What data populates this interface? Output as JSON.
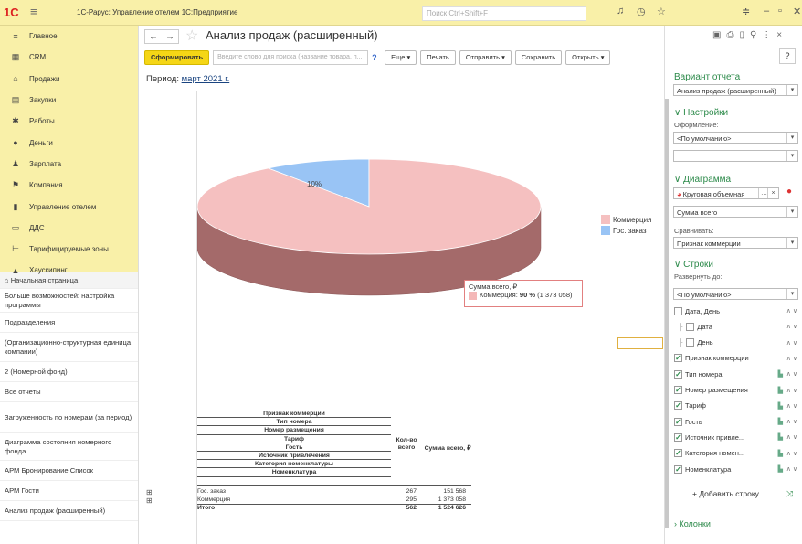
{
  "app": {
    "logo": "1С",
    "title": "1С-Рарус: Управление отелем 1С:Предприятие",
    "search_placeholder": "Поиск Ctrl+Shift+F"
  },
  "sections": [
    {
      "icon": "≡",
      "label": "Главное"
    },
    {
      "icon": "▦",
      "label": "CRM"
    },
    {
      "icon": "⌂",
      "label": "Продажи"
    },
    {
      "icon": "▤",
      "label": "Закупки"
    },
    {
      "icon": "✱",
      "label": "Работы"
    },
    {
      "icon": "●",
      "label": "Деньги"
    },
    {
      "icon": "♟",
      "label": "Зарплата"
    },
    {
      "icon": "⚑",
      "label": "Компания"
    },
    {
      "icon": "▮",
      "label": "Управление отелем"
    },
    {
      "icon": "▭",
      "label": "ДДС"
    },
    {
      "icon": "⊢",
      "label": "Тарифицируемые зоны"
    },
    {
      "icon": "▲",
      "label": "Хаускипинг"
    }
  ],
  "nav": [
    {
      "label": "⌂  Начальная страница",
      "h": 18
    },
    {
      "label": "Больше возможностей: настройка программы",
      "h": 26
    },
    {
      "label": "Подразделения",
      "h": 22
    },
    {
      "label": "(Организационно-структурная единица компании)",
      "h": 32
    },
    {
      "label": "2 (Номерной фонд)",
      "h": 22
    },
    {
      "label": "Все отчеты",
      "h": 22
    },
    {
      "label": "Загруженность по номерам (за период)",
      "h": 34
    },
    {
      "label": "Диаграмма состояния номерного фонда",
      "h": 30
    },
    {
      "label": "АРМ Бронирование Список",
      "h": 22
    },
    {
      "label": "АРМ Гости",
      "h": 22
    },
    {
      "label": "Анализ продаж (расширенный)",
      "h": 22
    }
  ],
  "doc": {
    "title": "Анализ продаж (расширенный)",
    "period_label": "Период:",
    "period_value": "март 2021 г."
  },
  "toolbar": {
    "generate": "Сформировать",
    "search_placeholder": "Введите слово для поиска (название товара, п...",
    "help": "?",
    "more": "Еще ▾",
    "print": "Печать",
    "send": "Отправить ▾",
    "save": "Сохранить",
    "open": "Открыть ▾"
  },
  "chart_data": {
    "type": "pie",
    "categories": [
      "Коммерция",
      "Гос. заказ"
    ],
    "values": [
      90,
      10
    ],
    "colors": [
      "#f5c0c0",
      "#99c4f5"
    ],
    "side_color": "#a46a6a",
    "labels": [
      "90%",
      "10%"
    ],
    "tooltip": {
      "title": "Сумма всего, ₽",
      "series": "Коммерция:",
      "percent": "90 %",
      "value": "(1 373 058)"
    }
  },
  "table": {
    "headers": [
      "Признак коммерции",
      "Тип номера",
      "Номер размещения",
      "Тариф",
      "Гость",
      "Источник привлечения",
      "Категория номенклатуры",
      "Номенклатура"
    ],
    "qty_header": "Кол-во всего",
    "sum_header": "Сумма всего, ₽",
    "rows": [
      {
        "name": "Гос. заказ",
        "qty": "267",
        "sum": "151 568"
      },
      {
        "name": "Коммерция",
        "qty": "295",
        "sum": "1 373 058"
      },
      {
        "name": "Итого",
        "qty": "562",
        "sum": "1 524 626"
      }
    ]
  },
  "settings": {
    "variant_title": "Вариант отчета",
    "variant_value": "Анализ продаж (расширенный)",
    "settings_title": "∨ Настройки",
    "design_label": "Оформление:",
    "design_value": "<По умолчанию>",
    "chart_title": "∨ Диаграмма",
    "chart_type": "Круговая объемная",
    "chart_measure": "Сумма всего",
    "compare_label": "Сравнивать:",
    "compare_value": "Признак коммерции",
    "rows_title": "∨ Строки",
    "expand_label": "Развернуть до:",
    "expand_value": "<По умолчанию>",
    "fields": [
      {
        "label": "Дата, День",
        "checked": false,
        "indent": 0,
        "grp": false
      },
      {
        "label": "Дата",
        "checked": false,
        "indent": 1,
        "grp": false
      },
      {
        "label": "День",
        "checked": false,
        "indent": 1,
        "grp": false
      },
      {
        "label": "Признак коммерции",
        "checked": true,
        "indent": 0,
        "grp": false
      },
      {
        "label": "Тип номера",
        "checked": true,
        "indent": 0,
        "grp": true
      },
      {
        "label": "Номер размещения",
        "checked": true,
        "indent": 0,
        "grp": true
      },
      {
        "label": "Тариф",
        "checked": true,
        "indent": 0,
        "grp": true
      },
      {
        "label": "Гость",
        "checked": true,
        "indent": 0,
        "grp": true
      },
      {
        "label": "Источник привле...",
        "checked": true,
        "indent": 0,
        "grp": true
      },
      {
        "label": "Категория номен...",
        "checked": true,
        "indent": 0,
        "grp": true
      },
      {
        "label": "Номенклатура",
        "checked": true,
        "indent": 0,
        "grp": true
      }
    ],
    "add_row": "+ Добавить строку",
    "columns_title": "› Колонки",
    "help": "?"
  }
}
